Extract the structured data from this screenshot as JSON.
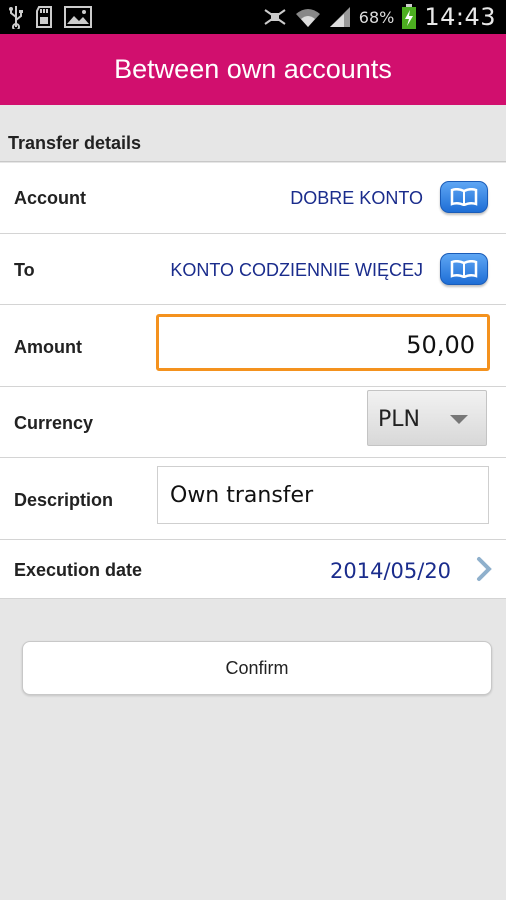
{
  "status_bar": {
    "icons": [
      "usb-icon",
      "sd-card-icon",
      "image-icon",
      "mute-icon",
      "wifi-icon",
      "signal-icon",
      "battery-icon"
    ],
    "battery_percent": "68%",
    "time": "14:43"
  },
  "header": {
    "title": "Between own accounts",
    "color": "#d10f6e"
  },
  "section": {
    "title": "Transfer details"
  },
  "form": {
    "account": {
      "label": "Account",
      "value": "DOBRE KONTO"
    },
    "to": {
      "label": "To",
      "value": "KONTO CODZIENNIE WIĘCEJ"
    },
    "amount": {
      "label": "Amount",
      "value": "50,00"
    },
    "currency": {
      "label": "Currency",
      "value": "PLN"
    },
    "description": {
      "label": "Description",
      "value": "Own transfer"
    },
    "execution_date": {
      "label": "Execution date",
      "value": "2014/05/20"
    }
  },
  "actions": {
    "confirm_label": "Confirm"
  },
  "colors": {
    "link": "#1a2c8c",
    "focus_border": "#f4921e",
    "button_blue": "#1e6ed6"
  }
}
